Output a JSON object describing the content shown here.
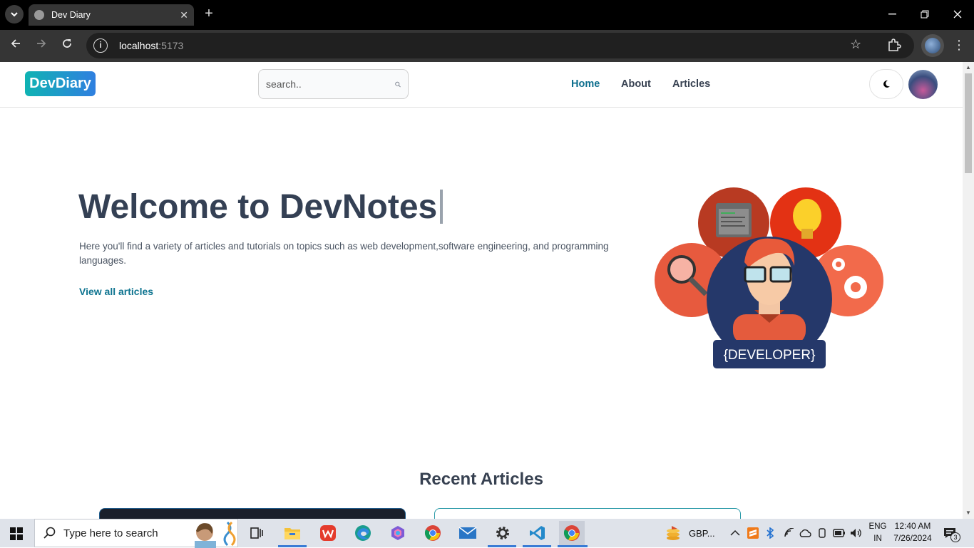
{
  "browser": {
    "tab_title": "Dev Diary",
    "url_host": "localhost",
    "url_port": ":5173"
  },
  "site": {
    "logo": "DevDiary",
    "search_placeholder": "search..",
    "nav": [
      {
        "label": "Home"
      },
      {
        "label": "About"
      },
      {
        "label": "Articles"
      }
    ],
    "theme_icon": "moon-icon"
  },
  "hero": {
    "title": "Welcome to DevNotes",
    "description": "Here you'll find a variety of articles and tutorials on topics such as web development,software engineering, and programming languages.",
    "cta": "View all articles",
    "badge": "{DEVELOPER}"
  },
  "recent": {
    "heading": "Recent Articles"
  },
  "taskbar": {
    "search_placeholder": "Type here to search",
    "weather": "GBP...",
    "lang_top": "ENG",
    "lang_bottom": "IN",
    "time": "12:40 AM",
    "date": "7/26/2024",
    "notifications": "3"
  },
  "colors": {
    "accent": "#0e6f8e",
    "logo_gradient_start": "#0fb3b3",
    "logo_gradient_end": "#2f7fe0",
    "title": "#344054"
  }
}
